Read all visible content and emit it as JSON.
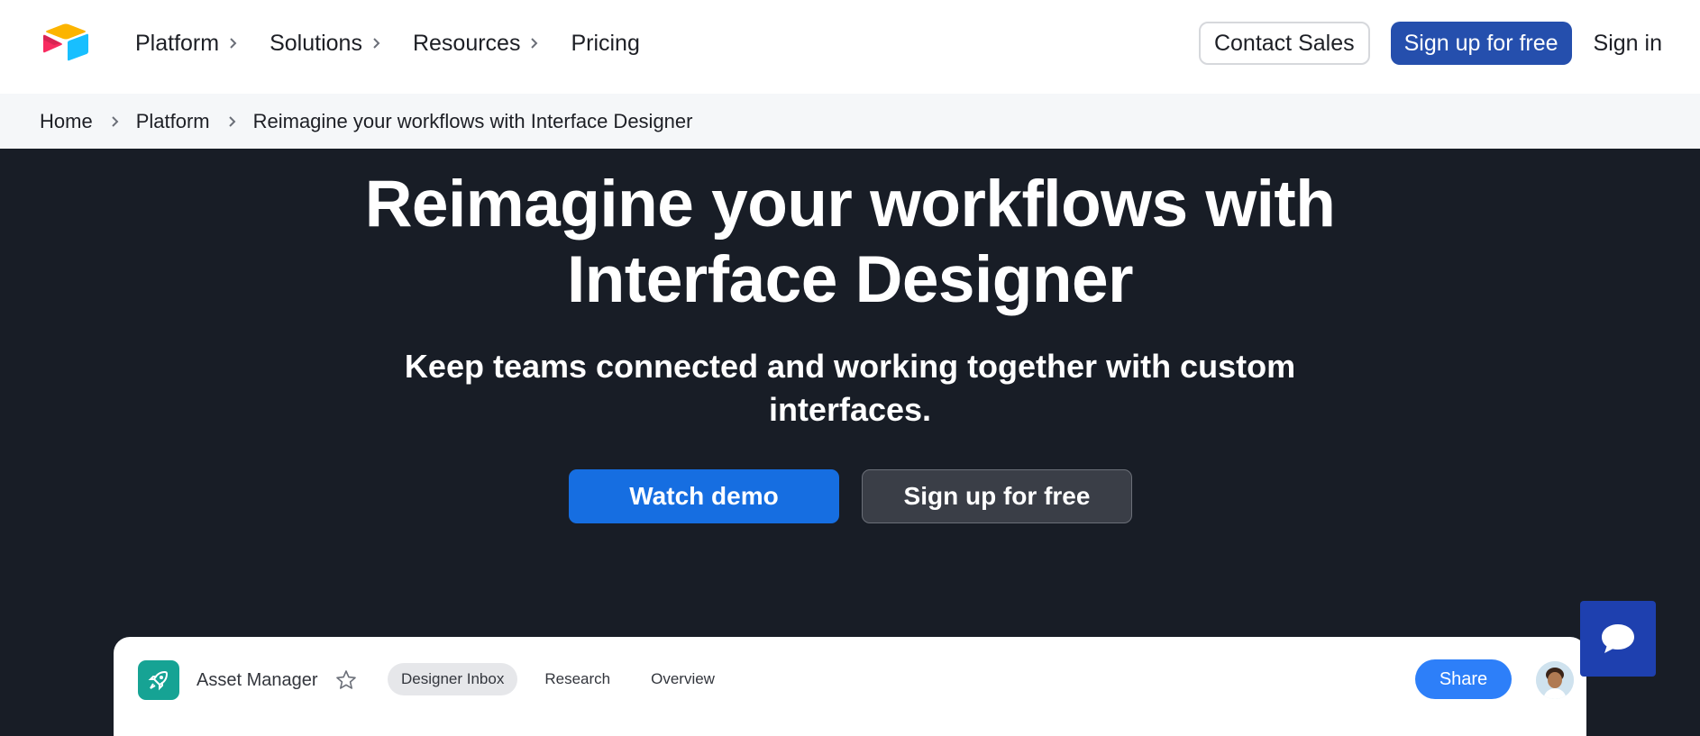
{
  "nav": {
    "items": [
      {
        "label": "Platform",
        "has_chevron": true
      },
      {
        "label": "Solutions",
        "has_chevron": true
      },
      {
        "label": "Resources",
        "has_chevron": true
      },
      {
        "label": "Pricing",
        "has_chevron": false
      }
    ],
    "contact_sales": "Contact Sales",
    "sign_up": "Sign up for free",
    "sign_in": "Sign in"
  },
  "breadcrumb": {
    "items": [
      "Home",
      "Platform",
      "Reimagine your workflows with Interface Designer"
    ]
  },
  "hero": {
    "title_line1": "Reimagine your workflows with",
    "title_line2": "Interface Designer",
    "subtitle_line1": "Keep teams connected and working together with custom",
    "subtitle_line2": "interfaces.",
    "watch_demo": "Watch demo",
    "sign_up": "Sign up for free"
  },
  "preview": {
    "app_name": "Asset Manager",
    "tabs": [
      {
        "label": "Designer Inbox",
        "active": true
      },
      {
        "label": "Research",
        "active": false
      },
      {
        "label": "Overview",
        "active": false
      }
    ],
    "share": "Share"
  },
  "colors": {
    "nav_signup_bg": "#254fad",
    "hero_bg": "#181d26",
    "demo_btn": "#166ee1",
    "share_btn": "#2d7ff9",
    "app_icon_bg": "#16a394",
    "chat_btn": "#1e40af"
  },
  "icons": {
    "logo": "airtable-logo",
    "app": "rocket-icon",
    "favorite": "star-icon",
    "chat": "chat-bubble-icon"
  }
}
